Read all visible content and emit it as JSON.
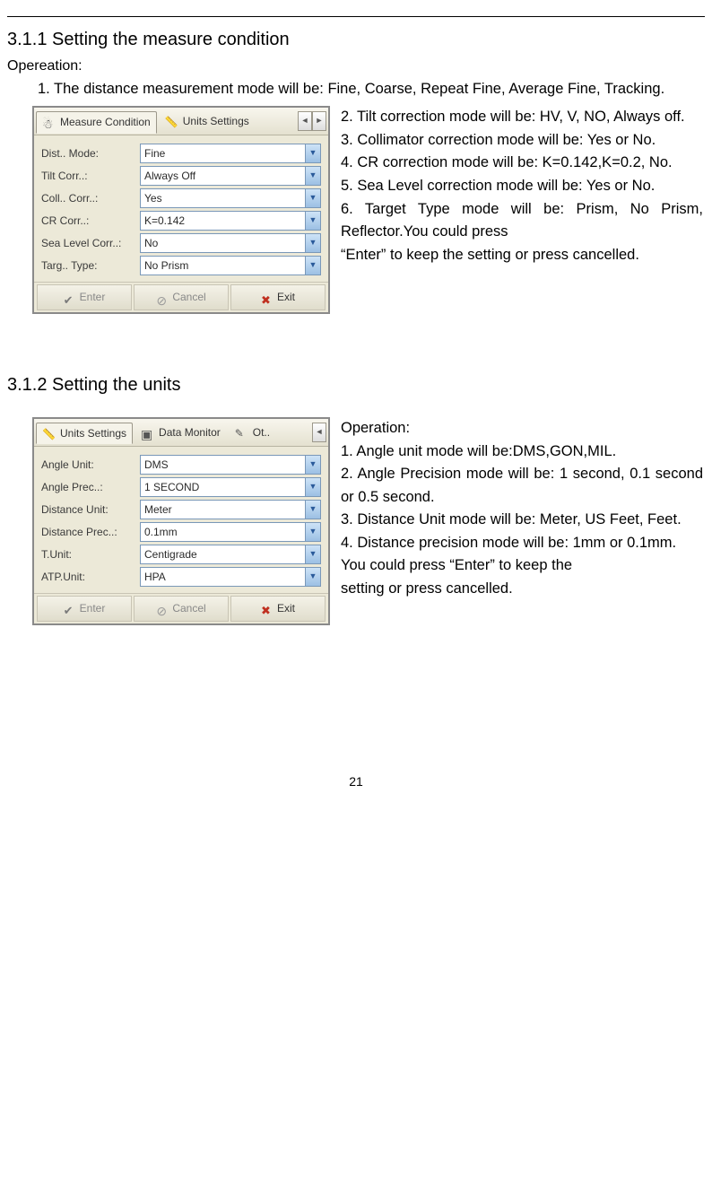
{
  "page_number": "21",
  "sec311": {
    "title": "3.1.1 Setting the measure condition",
    "op_label": "Opereation:",
    "para1": "1. The distance measurement mode will be: Fine, Coarse, Repeat Fine, Average Fine, Tracking.",
    "side2": "2. Tilt correction mode will be: HV, V, NO, Always off.",
    "side3": "3. Collimator correction mode will be: Yes or No.",
    "side4": "4. CR correction mode will be: K=0.142,K=0.2, No.",
    "side5": "5. Sea Level correction mode will be: Yes or No.",
    "side6a": "6. Target Type mode will be: Prism, No Prism, Reflector.You could press",
    "wrap6b": "“Enter” to keep the setting or press cancelled."
  },
  "sec312": {
    "title": "3.1.2 Setting the units",
    "op_label": "Operation:",
    "side1": "1. Angle unit mode will be:DMS,GON,MIL.",
    "side2": "2. Angle Precision mode will be: 1 second, 0.1 second or 0.5 second.",
    "side3": "3. Distance Unit mode will be: Meter, US Feet, Feet.",
    "side4": "4. Distance precision mode will be: 1mm or 0.1mm.",
    "side5a": "You could press “Enter” to keep the",
    "wrap5b": "setting or press cancelled."
  },
  "ss1": {
    "tabs": {
      "a": "Measure Condition",
      "b": "Units Settings"
    },
    "rows": {
      "r1_l": "Dist.. Mode:",
      "r1_v": "Fine",
      "r2_l": "Tilt Corr..:",
      "r2_v": "Always Off",
      "r3_l": "Coll.. Corr..:",
      "r3_v": "Yes",
      "r4_l": "CR Corr..:",
      "r4_v": "K=0.142",
      "r5_l": "Sea Level Corr..:",
      "r5_v": "No",
      "r6_l": "Targ.. Type:",
      "r6_v": "No Prism"
    },
    "btns": {
      "enter": "Enter",
      "cancel": "Cancel",
      "exit": "Exit"
    }
  },
  "ss2": {
    "tabs": {
      "a": "Units Settings",
      "b": "Data Monitor",
      "c": "Ot.."
    },
    "rows": {
      "r1_l": "Angle Unit:",
      "r1_v": "DMS",
      "r2_l": "Angle Prec..:",
      "r2_v": "1 SECOND",
      "r3_l": "Distance Unit:",
      "r3_v": "Meter",
      "r4_l": "Distance Prec..:",
      "r4_v": "0.1mm",
      "r5_l": "T.Unit:",
      "r5_v": "Centigrade",
      "r6_l": "ATP.Unit:",
      "r6_v": "HPA"
    },
    "btns": {
      "enter": "Enter",
      "cancel": "Cancel",
      "exit": "Exit"
    }
  }
}
